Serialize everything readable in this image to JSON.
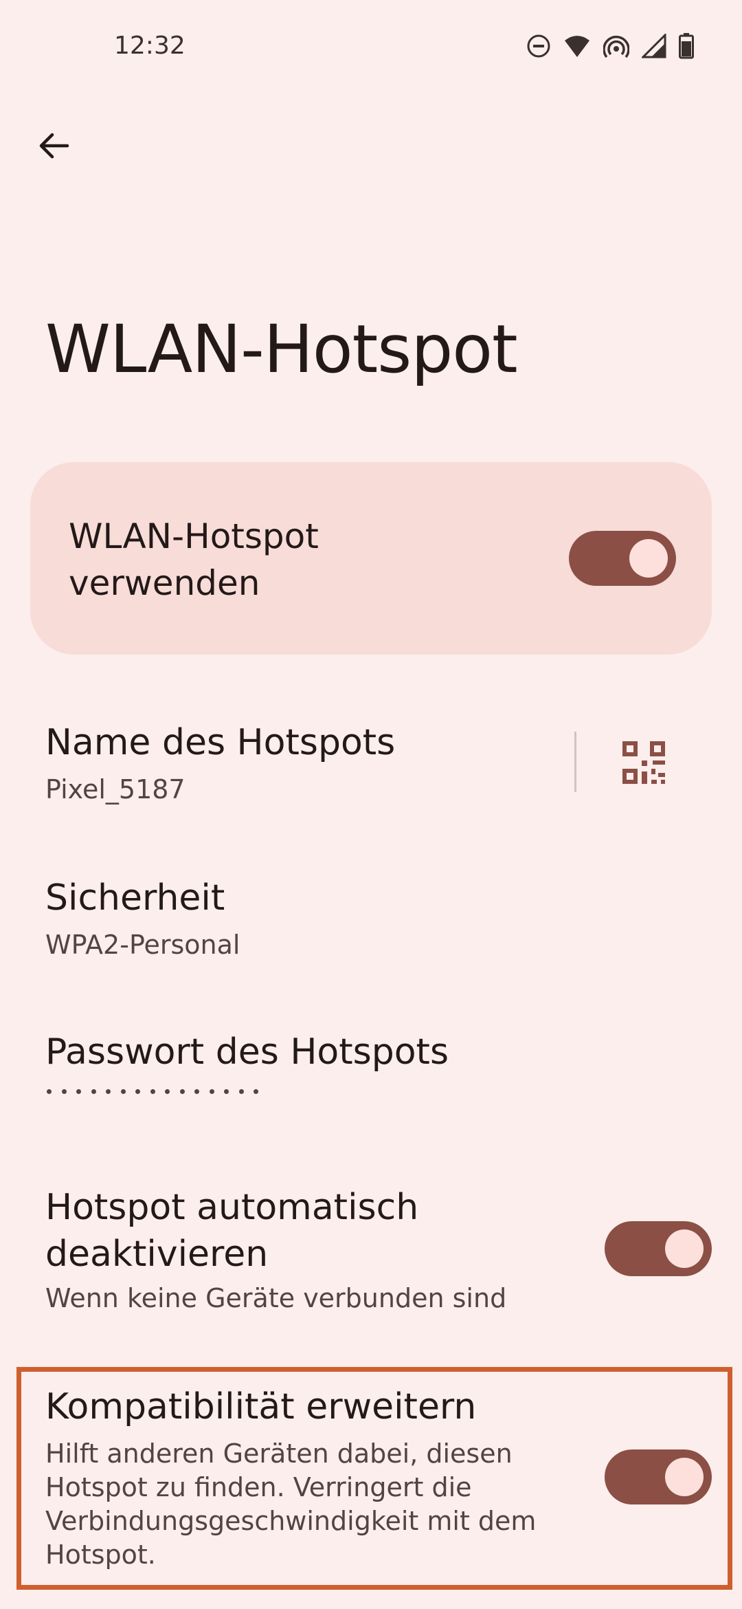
{
  "status_bar": {
    "time": "12:32",
    "icons": [
      "do-not-disturb-icon",
      "wifi-icon",
      "hotspot-icon",
      "cell-signal-icon",
      "battery-icon"
    ]
  },
  "header": {
    "back_icon": "arrow-back-icon",
    "title": "WLAN-Hotspot"
  },
  "master_switch": {
    "label": "WLAN-Hotspot verwenden",
    "on": true
  },
  "settings": {
    "hotspot_name": {
      "title": "Name des Hotspots",
      "value": "Pixel_5187",
      "icon": "qr-code-icon"
    },
    "security": {
      "title": "Sicherheit",
      "value": "WPA2-Personal"
    },
    "password": {
      "title": "Passwort des Hotspots",
      "masked_length": 15
    },
    "auto_off": {
      "title_line1": "Hotspot automatisch",
      "title_line2": "deaktivieren",
      "subtitle": "Wenn keine Geräte verbunden sind",
      "on": true
    },
    "compatibility": {
      "title": "Kompatibilität erweitern",
      "subtitle_lines": [
        "Hilft anderen Geräten dabei, diesen",
        "Hotspot zu finden. Verringert die",
        "Verbindungsgeschwindigkeit mit dem",
        "Hotspot."
      ],
      "on": true
    }
  },
  "colors": {
    "background": "#fbeeec",
    "card": "#f7dcd8",
    "toggle_track": "#8b4f45",
    "toggle_knob": "#fde0dc",
    "highlight": "#cf5f2f"
  }
}
